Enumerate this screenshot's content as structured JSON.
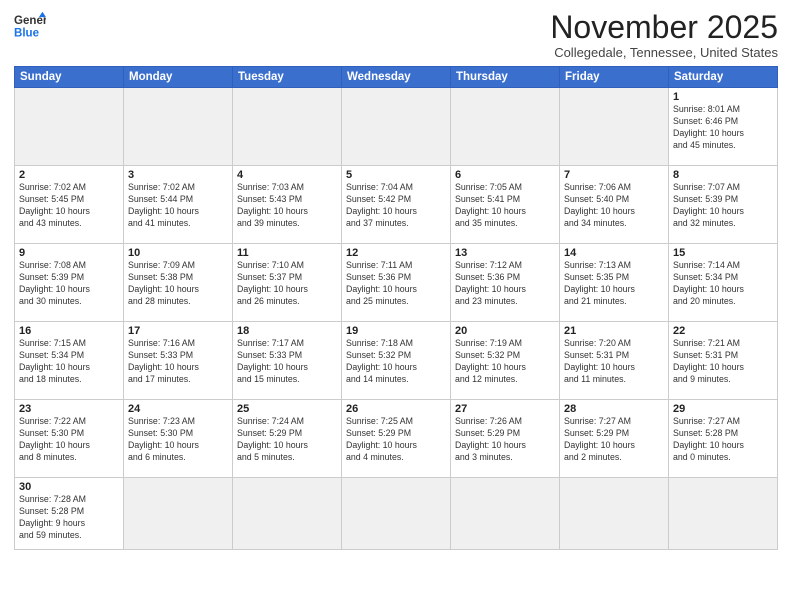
{
  "header": {
    "logo_general": "General",
    "logo_blue": "Blue",
    "month_title": "November 2025",
    "location": "Collegedale, Tennessee, United States"
  },
  "weekdays": [
    "Sunday",
    "Monday",
    "Tuesday",
    "Wednesday",
    "Thursday",
    "Friday",
    "Saturday"
  ],
  "weeks": [
    [
      {
        "day": "",
        "info": "",
        "empty": true
      },
      {
        "day": "",
        "info": "",
        "empty": true
      },
      {
        "day": "",
        "info": "",
        "empty": true
      },
      {
        "day": "",
        "info": "",
        "empty": true
      },
      {
        "day": "",
        "info": "",
        "empty": true
      },
      {
        "day": "",
        "info": "",
        "empty": true
      },
      {
        "day": "1",
        "info": "Sunrise: 8:01 AM\nSunset: 6:46 PM\nDaylight: 10 hours\nand 45 minutes."
      }
    ],
    [
      {
        "day": "2",
        "info": "Sunrise: 7:02 AM\nSunset: 5:45 PM\nDaylight: 10 hours\nand 43 minutes."
      },
      {
        "day": "3",
        "info": "Sunrise: 7:02 AM\nSunset: 5:44 PM\nDaylight: 10 hours\nand 41 minutes."
      },
      {
        "day": "4",
        "info": "Sunrise: 7:03 AM\nSunset: 5:43 PM\nDaylight: 10 hours\nand 39 minutes."
      },
      {
        "day": "5",
        "info": "Sunrise: 7:04 AM\nSunset: 5:42 PM\nDaylight: 10 hours\nand 37 minutes."
      },
      {
        "day": "6",
        "info": "Sunrise: 7:05 AM\nSunset: 5:41 PM\nDaylight: 10 hours\nand 35 minutes."
      },
      {
        "day": "7",
        "info": "Sunrise: 7:06 AM\nSunset: 5:40 PM\nDaylight: 10 hours\nand 34 minutes."
      },
      {
        "day": "8",
        "info": "Sunrise: 7:07 AM\nSunset: 5:39 PM\nDaylight: 10 hours\nand 32 minutes."
      }
    ],
    [
      {
        "day": "9",
        "info": "Sunrise: 7:08 AM\nSunset: 5:39 PM\nDaylight: 10 hours\nand 30 minutes."
      },
      {
        "day": "10",
        "info": "Sunrise: 7:09 AM\nSunset: 5:38 PM\nDaylight: 10 hours\nand 28 minutes."
      },
      {
        "day": "11",
        "info": "Sunrise: 7:10 AM\nSunset: 5:37 PM\nDaylight: 10 hours\nand 26 minutes."
      },
      {
        "day": "12",
        "info": "Sunrise: 7:11 AM\nSunset: 5:36 PM\nDaylight: 10 hours\nand 25 minutes."
      },
      {
        "day": "13",
        "info": "Sunrise: 7:12 AM\nSunset: 5:36 PM\nDaylight: 10 hours\nand 23 minutes."
      },
      {
        "day": "14",
        "info": "Sunrise: 7:13 AM\nSunset: 5:35 PM\nDaylight: 10 hours\nand 21 minutes."
      },
      {
        "day": "15",
        "info": "Sunrise: 7:14 AM\nSunset: 5:34 PM\nDaylight: 10 hours\nand 20 minutes."
      }
    ],
    [
      {
        "day": "16",
        "info": "Sunrise: 7:15 AM\nSunset: 5:34 PM\nDaylight: 10 hours\nand 18 minutes."
      },
      {
        "day": "17",
        "info": "Sunrise: 7:16 AM\nSunset: 5:33 PM\nDaylight: 10 hours\nand 17 minutes."
      },
      {
        "day": "18",
        "info": "Sunrise: 7:17 AM\nSunset: 5:33 PM\nDaylight: 10 hours\nand 15 minutes."
      },
      {
        "day": "19",
        "info": "Sunrise: 7:18 AM\nSunset: 5:32 PM\nDaylight: 10 hours\nand 14 minutes."
      },
      {
        "day": "20",
        "info": "Sunrise: 7:19 AM\nSunset: 5:32 PM\nDaylight: 10 hours\nand 12 minutes."
      },
      {
        "day": "21",
        "info": "Sunrise: 7:20 AM\nSunset: 5:31 PM\nDaylight: 10 hours\nand 11 minutes."
      },
      {
        "day": "22",
        "info": "Sunrise: 7:21 AM\nSunset: 5:31 PM\nDaylight: 10 hours\nand 9 minutes."
      }
    ],
    [
      {
        "day": "23",
        "info": "Sunrise: 7:22 AM\nSunset: 5:30 PM\nDaylight: 10 hours\nand 8 minutes."
      },
      {
        "day": "24",
        "info": "Sunrise: 7:23 AM\nSunset: 5:30 PM\nDaylight: 10 hours\nand 6 minutes."
      },
      {
        "day": "25",
        "info": "Sunrise: 7:24 AM\nSunset: 5:29 PM\nDaylight: 10 hours\nand 5 minutes."
      },
      {
        "day": "26",
        "info": "Sunrise: 7:25 AM\nSunset: 5:29 PM\nDaylight: 10 hours\nand 4 minutes."
      },
      {
        "day": "27",
        "info": "Sunrise: 7:26 AM\nSunset: 5:29 PM\nDaylight: 10 hours\nand 3 minutes."
      },
      {
        "day": "28",
        "info": "Sunrise: 7:27 AM\nSunset: 5:29 PM\nDaylight: 10 hours\nand 2 minutes."
      },
      {
        "day": "29",
        "info": "Sunrise: 7:27 AM\nSunset: 5:28 PM\nDaylight: 10 hours\nand 0 minutes."
      }
    ],
    [
      {
        "day": "30",
        "info": "Sunrise: 7:28 AM\nSunset: 5:28 PM\nDaylight: 9 hours\nand 59 minutes."
      },
      {
        "day": "",
        "info": "",
        "empty": true
      },
      {
        "day": "",
        "info": "",
        "empty": true
      },
      {
        "day": "",
        "info": "",
        "empty": true
      },
      {
        "day": "",
        "info": "",
        "empty": true
      },
      {
        "day": "",
        "info": "",
        "empty": true
      },
      {
        "day": "",
        "info": "",
        "empty": true
      }
    ]
  ]
}
